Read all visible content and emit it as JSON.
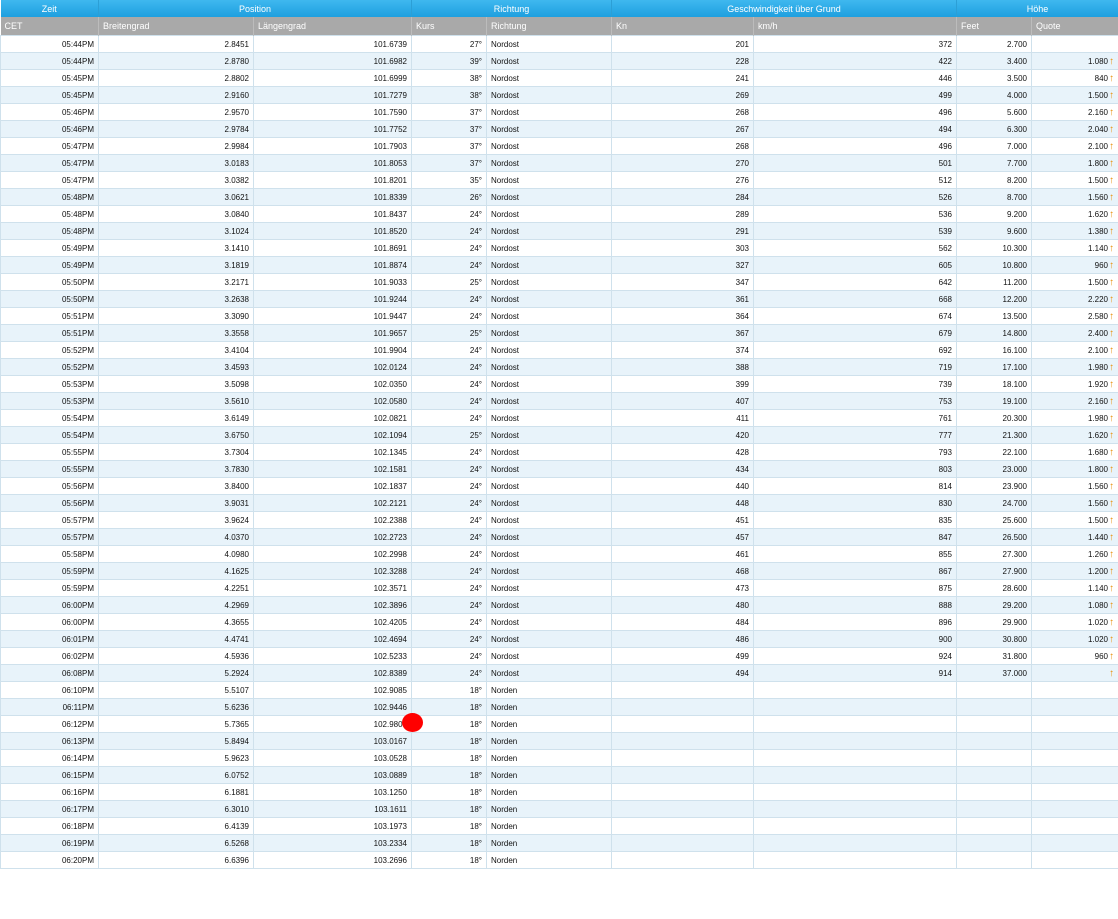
{
  "group_headers": [
    "Zeit",
    "Position",
    "Richtung",
    "Geschwindigkeit über Grund",
    "Höhe"
  ],
  "sub_headers": [
    "CET",
    "Breitengrad",
    "Längengrad",
    "Kurs",
    "Richtung",
    "Kn",
    "km/h",
    "Feet",
    "Quote"
  ],
  "rows": [
    [
      "05:44PM",
      "2.8451",
      "101.6739",
      "27°",
      "Nordost",
      "201",
      "372",
      "2.700",
      ""
    ],
    [
      "05:44PM",
      "2.8780",
      "101.6982",
      "39°",
      "Nordost",
      "228",
      "422",
      "3.400",
      "1.080"
    ],
    [
      "05:45PM",
      "2.8802",
      "101.6999",
      "38°",
      "Nordost",
      "241",
      "446",
      "3.500",
      "840"
    ],
    [
      "05:45PM",
      "2.9160",
      "101.7279",
      "38°",
      "Nordost",
      "269",
      "499",
      "4.000",
      "1.500"
    ],
    [
      "05:46PM",
      "2.9570",
      "101.7590",
      "37°",
      "Nordost",
      "268",
      "496",
      "5.600",
      "2.160"
    ],
    [
      "05:46PM",
      "2.9784",
      "101.7752",
      "37°",
      "Nordost",
      "267",
      "494",
      "6.300",
      "2.040"
    ],
    [
      "05:47PM",
      "2.9984",
      "101.7903",
      "37°",
      "Nordost",
      "268",
      "496",
      "7.000",
      "2.100"
    ],
    [
      "05:47PM",
      "3.0183",
      "101.8053",
      "37°",
      "Nordost",
      "270",
      "501",
      "7.700",
      "1.800"
    ],
    [
      "05:47PM",
      "3.0382",
      "101.8201",
      "35°",
      "Nordost",
      "276",
      "512",
      "8.200",
      "1.500"
    ],
    [
      "05:48PM",
      "3.0621",
      "101.8339",
      "26°",
      "Nordost",
      "284",
      "526",
      "8.700",
      "1.560"
    ],
    [
      "05:48PM",
      "3.0840",
      "101.8437",
      "24°",
      "Nordost",
      "289",
      "536",
      "9.200",
      "1.620"
    ],
    [
      "05:48PM",
      "3.1024",
      "101.8520",
      "24°",
      "Nordost",
      "291",
      "539",
      "9.600",
      "1.380"
    ],
    [
      "05:49PM",
      "3.1410",
      "101.8691",
      "24°",
      "Nordost",
      "303",
      "562",
      "10.300",
      "1.140"
    ],
    [
      "05:49PM",
      "3.1819",
      "101.8874",
      "24°",
      "Nordost",
      "327",
      "605",
      "10.800",
      "960"
    ],
    [
      "05:50PM",
      "3.2171",
      "101.9033",
      "25°",
      "Nordost",
      "347",
      "642",
      "11.200",
      "1.500"
    ],
    [
      "05:50PM",
      "3.2638",
      "101.9244",
      "24°",
      "Nordost",
      "361",
      "668",
      "12.200",
      "2.220"
    ],
    [
      "05:51PM",
      "3.3090",
      "101.9447",
      "24°",
      "Nordost",
      "364",
      "674",
      "13.500",
      "2.580"
    ],
    [
      "05:51PM",
      "3.3558",
      "101.9657",
      "25°",
      "Nordost",
      "367",
      "679",
      "14.800",
      "2.400"
    ],
    [
      "05:52PM",
      "3.4104",
      "101.9904",
      "24°",
      "Nordost",
      "374",
      "692",
      "16.100",
      "2.100"
    ],
    [
      "05:52PM",
      "3.4593",
      "102.0124",
      "24°",
      "Nordost",
      "388",
      "719",
      "17.100",
      "1.980"
    ],
    [
      "05:53PM",
      "3.5098",
      "102.0350",
      "24°",
      "Nordost",
      "399",
      "739",
      "18.100",
      "1.920"
    ],
    [
      "05:53PM",
      "3.5610",
      "102.0580",
      "24°",
      "Nordost",
      "407",
      "753",
      "19.100",
      "2.160"
    ],
    [
      "05:54PM",
      "3.6149",
      "102.0821",
      "24°",
      "Nordost",
      "411",
      "761",
      "20.300",
      "1.980"
    ],
    [
      "05:54PM",
      "3.6750",
      "102.1094",
      "25°",
      "Nordost",
      "420",
      "777",
      "21.300",
      "1.620"
    ],
    [
      "05:55PM",
      "3.7304",
      "102.1345",
      "24°",
      "Nordost",
      "428",
      "793",
      "22.100",
      "1.680"
    ],
    [
      "05:55PM",
      "3.7830",
      "102.1581",
      "24°",
      "Nordost",
      "434",
      "803",
      "23.000",
      "1.800"
    ],
    [
      "05:56PM",
      "3.8400",
      "102.1837",
      "24°",
      "Nordost",
      "440",
      "814",
      "23.900",
      "1.560"
    ],
    [
      "05:56PM",
      "3.9031",
      "102.2121",
      "24°",
      "Nordost",
      "448",
      "830",
      "24.700",
      "1.560"
    ],
    [
      "05:57PM",
      "3.9624",
      "102.2388",
      "24°",
      "Nordost",
      "451",
      "835",
      "25.600",
      "1.500"
    ],
    [
      "05:57PM",
      "4.0370",
      "102.2723",
      "24°",
      "Nordost",
      "457",
      "847",
      "26.500",
      "1.440"
    ],
    [
      "05:58PM",
      "4.0980",
      "102.2998",
      "24°",
      "Nordost",
      "461",
      "855",
      "27.300",
      "1.260"
    ],
    [
      "05:59PM",
      "4.1625",
      "102.3288",
      "24°",
      "Nordost",
      "468",
      "867",
      "27.900",
      "1.200"
    ],
    [
      "05:59PM",
      "4.2251",
      "102.3571",
      "24°",
      "Nordost",
      "473",
      "875",
      "28.600",
      "1.140"
    ],
    [
      "06:00PM",
      "4.2969",
      "102.3896",
      "24°",
      "Nordost",
      "480",
      "888",
      "29.200",
      "1.080"
    ],
    [
      "06:00PM",
      "4.3655",
      "102.4205",
      "24°",
      "Nordost",
      "484",
      "896",
      "29.900",
      "1.020"
    ],
    [
      "06:01PM",
      "4.4741",
      "102.4694",
      "24°",
      "Nordost",
      "486",
      "900",
      "30.800",
      "1.020"
    ],
    [
      "06:02PM",
      "4.5936",
      "102.5233",
      "24°",
      "Nordost",
      "499",
      "924",
      "31.800",
      "960"
    ],
    [
      "06:08PM",
      "5.2924",
      "102.8389",
      "24°",
      "Nordost",
      "494",
      "914",
      "37.000",
      ""
    ],
    [
      "06:10PM",
      "5.5107",
      "102.9085",
      "18°",
      "Norden",
      "",
      "",
      "",
      ""
    ],
    [
      "06:11PM",
      "5.6236",
      "102.9446",
      "18°",
      "Norden",
      "",
      "",
      "",
      ""
    ],
    [
      "06:12PM",
      "5.7365",
      "102.9806",
      "18°",
      "Norden",
      "",
      "",
      "",
      ""
    ],
    [
      "06:13PM",
      "5.8494",
      "103.0167",
      "18°",
      "Norden",
      "",
      "",
      "",
      ""
    ],
    [
      "06:14PM",
      "5.9623",
      "103.0528",
      "18°",
      "Norden",
      "",
      "",
      "",
      ""
    ],
    [
      "06:15PM",
      "6.0752",
      "103.0889",
      "18°",
      "Norden",
      "",
      "",
      "",
      ""
    ],
    [
      "06:16PM",
      "6.1881",
      "103.1250",
      "18°",
      "Norden",
      "",
      "",
      "",
      ""
    ],
    [
      "06:17PM",
      "6.3010",
      "103.1611",
      "18°",
      "Norden",
      "",
      "",
      "",
      ""
    ],
    [
      "06:18PM",
      "6.4139",
      "103.1973",
      "18°",
      "Norden",
      "",
      "",
      "",
      ""
    ],
    [
      "06:19PM",
      "6.5268",
      "103.2334",
      "18°",
      "Norden",
      "",
      "",
      "",
      ""
    ],
    [
      "06:20PM",
      "6.6396",
      "103.2696",
      "18°",
      "Norden",
      "",
      "",
      "",
      ""
    ]
  ],
  "arrow_rows": [
    1,
    2,
    3,
    4,
    5,
    6,
    7,
    8,
    9,
    10,
    11,
    12,
    13,
    14,
    15,
    16,
    17,
    18,
    19,
    20,
    21,
    22,
    23,
    24,
    25,
    26,
    27,
    28,
    29,
    30,
    31,
    32,
    33,
    34,
    35,
    36,
    37
  ],
  "arrow_icon": "arrow-up-icon",
  "colors": {
    "header_blue": "#1e9fdf",
    "subheader_gray": "#a9a9a9",
    "row_alt": "#e8f3fa",
    "arrow_orange": "#e8920c",
    "marker_red": "#ff0000"
  }
}
